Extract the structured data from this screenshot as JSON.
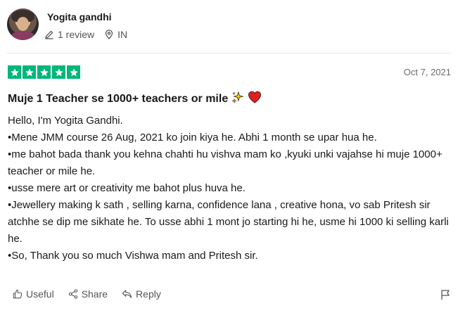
{
  "reviewer": {
    "name": "Yogita gandhi",
    "review_count": "1 review",
    "country": "IN"
  },
  "review": {
    "rating": 5,
    "date": "Oct 7, 2021",
    "title": "Muje 1 Teacher se 1000+ teachers or mile",
    "title_emojis": [
      "sparkles-icon",
      "heart-icon"
    ],
    "body_lines": [
      "Hello, I'm Yogita Gandhi.",
      "•Mene JMM course 26 Aug, 2021 ko join kiya he. Abhi 1 month se upar hua he.",
      "•me bahot bada thank you kehna chahti hu vishva mam ko ,kyuki unki vajahse hi muje 1000+ teacher or mile he.",
      "•usse mere art or creativity me bahot plus huva he.",
      "•Jewellery making k sath , selling karna, confidence lana , creative hona, vo sab Pritesh sir atchhe se dip me sikhate he. To usse abhi 1 mont jo starting hi he, usme hi 1000 ki selling karli he.",
      "•So, Thank you so much Vishwa mam and Pritesh sir."
    ]
  },
  "actions": {
    "useful": "Useful",
    "share": "Share",
    "reply": "Reply"
  },
  "colors": {
    "star_green": "#00b67a",
    "heart_red": "#e02020",
    "sparkle_yellow": "#f5c518"
  }
}
